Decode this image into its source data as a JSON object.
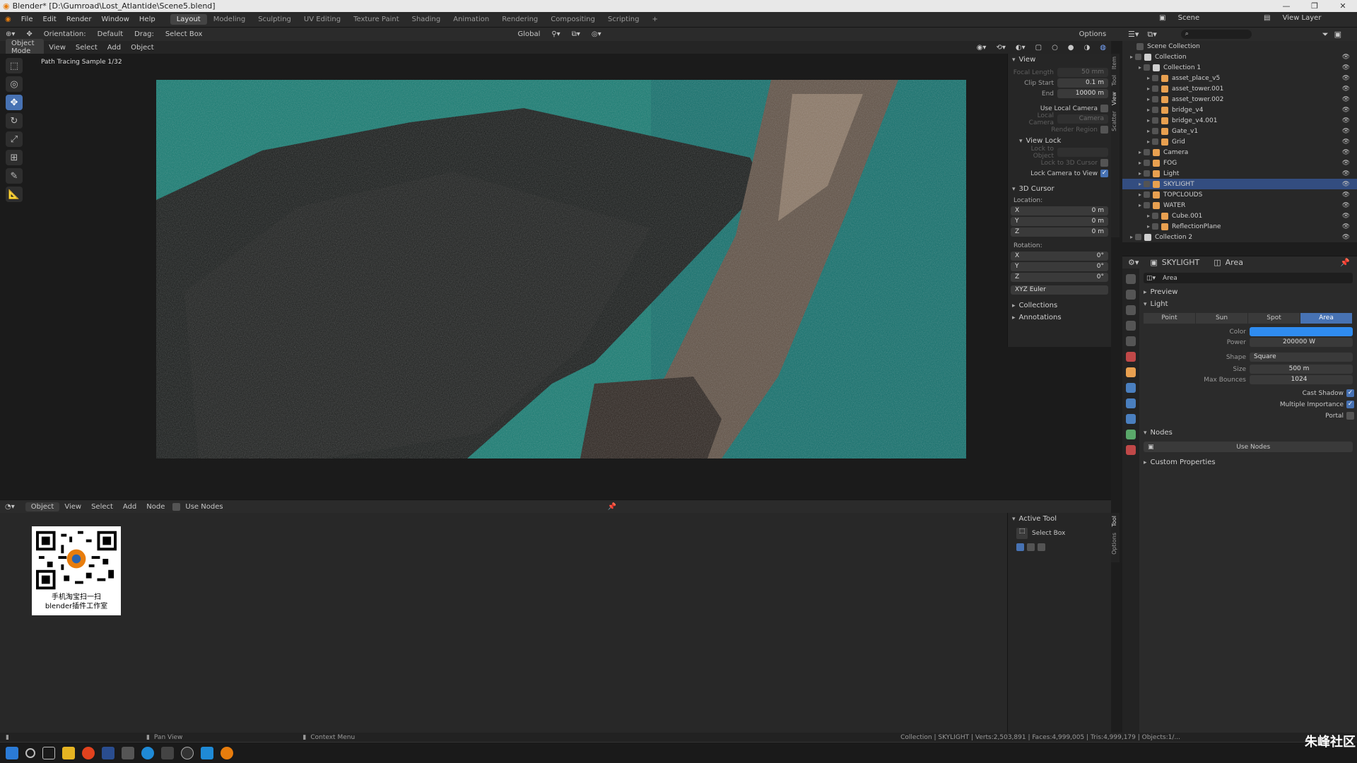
{
  "app": {
    "title": "Blender* [D:\\Gumroad\\Lost_Atlantide\\Scene5.blend]",
    "accent_color": "#4772b3"
  },
  "menu": [
    "File",
    "Edit",
    "Render",
    "Window",
    "Help"
  ],
  "workspaces": [
    "Layout",
    "Modeling",
    "Sculpting",
    "UV Editing",
    "Texture Paint",
    "Shading",
    "Animation",
    "Rendering",
    "Compositing",
    "Scripting"
  ],
  "active_workspace": "Layout",
  "top_right": {
    "scene": "Scene",
    "view_layer": "View Layer"
  },
  "tool_header": {
    "orientation_label": "Orientation:",
    "orientation_value": "Default",
    "drag_label": "Drag:",
    "drag_value": "Select Box",
    "transform": "Global",
    "options": "Options"
  },
  "viewport": {
    "mode": "Object Mode",
    "menus": [
      "View",
      "Select",
      "Add",
      "Object"
    ],
    "overlay_text": "Path Tracing Sample 1/32"
  },
  "npanel": {
    "view_header": "View",
    "focal_length_label": "Focal Length",
    "focal_length": "50 mm",
    "clip_start_label": "Clip Start",
    "clip_start": "0.1 m",
    "end_label": "End",
    "end": "10000 m",
    "use_local_camera": "Use Local Camera",
    "local_camera_label": "Local Camera",
    "local_camera": "Camera",
    "render_region": "Render Region",
    "view_lock_header": "View Lock",
    "lock_to_object": "Lock to Object",
    "lock_to_cursor": "Lock to 3D Cursor",
    "lock_camera_to_view": "Lock Camera to View",
    "cursor_header": "3D Cursor",
    "location_label": "Location:",
    "loc": [
      {
        "axis": "X",
        "value": "0 m"
      },
      {
        "axis": "Y",
        "value": "0 m"
      },
      {
        "axis": "Z",
        "value": "0 m"
      }
    ],
    "rotation_label": "Rotation:",
    "rot": [
      {
        "axis": "X",
        "value": "0°"
      },
      {
        "axis": "Y",
        "value": "0°"
      },
      {
        "axis": "Z",
        "value": "0°"
      }
    ],
    "rotation_mode": "XYZ Euler",
    "collections": "Collections",
    "annotations": "Annotations",
    "tabs": [
      "Item",
      "Tool",
      "View",
      "Scatter"
    ]
  },
  "node_editor": {
    "type": "Object",
    "menus": [
      "View",
      "Select",
      "Add",
      "Node"
    ],
    "use_nodes": "Use Nodes",
    "qr_caption_1": "手机淘宝扫一扫",
    "qr_caption_2": "blender插件工作室",
    "active_tool_header": "Active Tool",
    "active_tool": "Select Box",
    "tabs": [
      "Tool",
      "Options"
    ]
  },
  "outliner": {
    "root": "Scene Collection",
    "items": [
      {
        "name": "Collection",
        "depth": 0,
        "color": "#cfcfcf",
        "sel": false
      },
      {
        "name": "Collection 1",
        "depth": 1,
        "color": "#cfcfcf",
        "sel": false
      },
      {
        "name": "asset_place_v5",
        "depth": 2,
        "color": "#e8a050",
        "sel": false
      },
      {
        "name": "asset_tower.001",
        "depth": 2,
        "color": "#e8a050",
        "sel": false
      },
      {
        "name": "asset_tower.002",
        "depth": 2,
        "color": "#e8a050",
        "sel": false
      },
      {
        "name": "bridge_v4",
        "depth": 2,
        "color": "#e8a050",
        "sel": false
      },
      {
        "name": "bridge_v4.001",
        "depth": 2,
        "color": "#e8a050",
        "sel": false
      },
      {
        "name": "Gate_v1",
        "depth": 2,
        "color": "#e8a050",
        "sel": false
      },
      {
        "name": "Grid",
        "depth": 2,
        "color": "#e8a050",
        "sel": false
      },
      {
        "name": "Camera",
        "depth": 1,
        "color": "#e8a050",
        "sel": false
      },
      {
        "name": "FOG",
        "depth": 1,
        "color": "#e8a050",
        "sel": false
      },
      {
        "name": "Light",
        "depth": 1,
        "color": "#e8a050",
        "sel": false
      },
      {
        "name": "SKYLIGHT",
        "depth": 1,
        "color": "#e8a050",
        "sel": true
      },
      {
        "name": "TOPCLOUDS",
        "depth": 1,
        "color": "#e8a050",
        "sel": false
      },
      {
        "name": "WATER",
        "depth": 1,
        "color": "#e8a050",
        "sel": false
      },
      {
        "name": "Cube.001",
        "depth": 2,
        "color": "#e8a050",
        "sel": false
      },
      {
        "name": "ReflectionPlane",
        "depth": 2,
        "color": "#e8a050",
        "sel": false
      },
      {
        "name": "Collection 2",
        "depth": 0,
        "color": "#cfcfcf",
        "sel": false
      }
    ]
  },
  "properties": {
    "object": "SKYLIGHT",
    "data": "Area",
    "datablock": "Area",
    "preview": "Preview",
    "light_header": "Light",
    "types": [
      "Point",
      "Sun",
      "Spot",
      "Area"
    ],
    "active_type": "Area",
    "color_label": "Color",
    "color_value": "#2f8cf0",
    "power_label": "Power",
    "power": "200000 W",
    "shape_label": "Shape",
    "shape": "Square",
    "size_label": "Size",
    "size": "500 m",
    "max_bounces_label": "Max Bounces",
    "max_bounces": "1024",
    "cast_shadow": "Cast Shadow",
    "multiple_importance": "Multiple Importance",
    "portal": "Portal",
    "nodes_header": "Nodes",
    "use_nodes": "Use Nodes",
    "custom_properties": "Custom Properties"
  },
  "status": {
    "left": "Pan View",
    "mid": "Context Menu",
    "right": "Collection | SKYLIGHT | Verts:2,503,891 | Faces:4,999,005 | Tris:4,999,179 | Objects:1/..."
  },
  "watermark": "朱峰社区"
}
